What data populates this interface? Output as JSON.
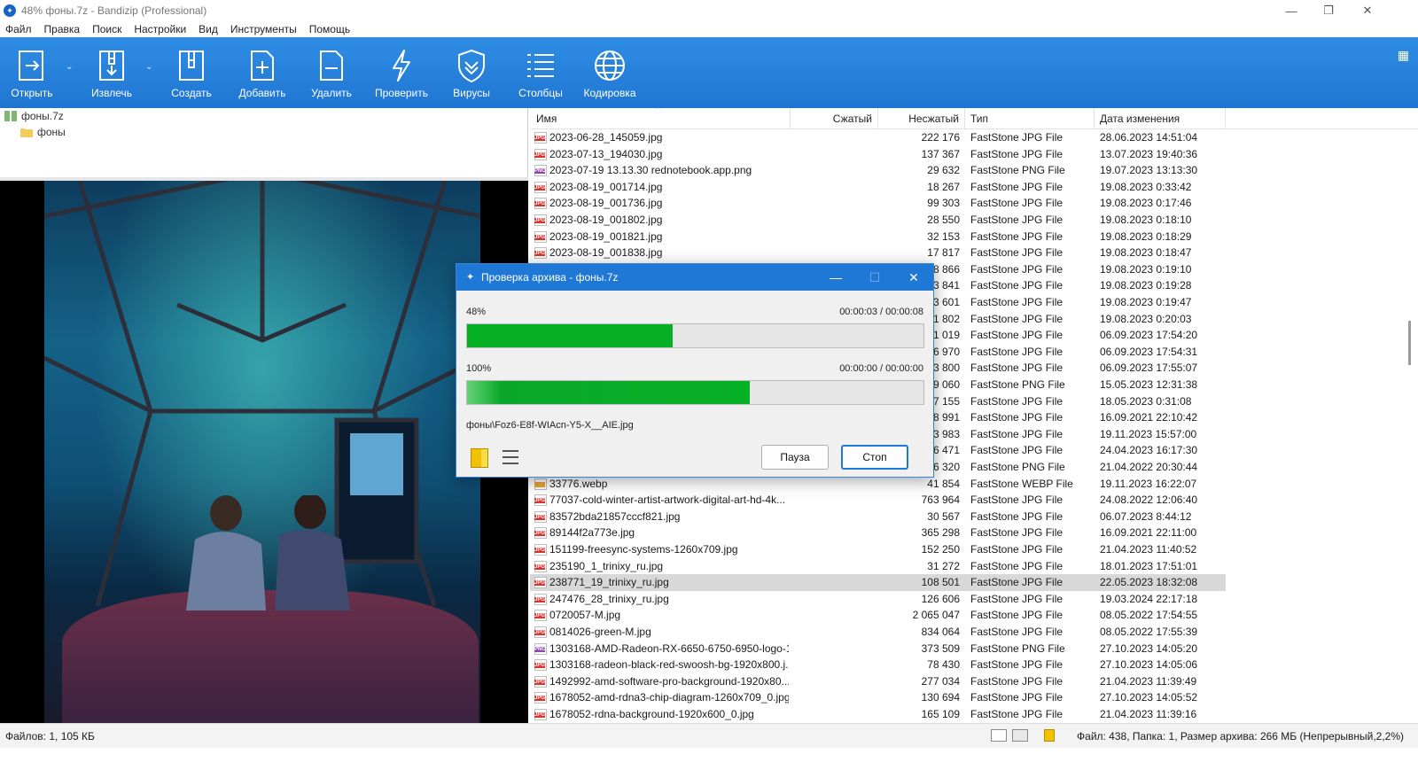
{
  "window": {
    "title": "48% фоны.7z - Bandizip (Professional)",
    "controls": {
      "minimize": "—",
      "maximize": "❐",
      "close": "✕"
    }
  },
  "menu": [
    "Файл",
    "Правка",
    "Поиск",
    "Настройки",
    "Вид",
    "Инструменты",
    "Помощь"
  ],
  "toolbar": {
    "open": "Открыть",
    "extract": "Извлечь",
    "create": "Создать",
    "add": "Добавить",
    "delete": "Удалить",
    "test": "Проверить",
    "virus": "Вирусы",
    "columns": "Столбцы",
    "encoding": "Кодировка"
  },
  "tree": {
    "archive": "фоны.7z",
    "folder": "фоны"
  },
  "columns": {
    "name": "Имя",
    "packed": "Сжатый",
    "size": "Несжатый",
    "type": "Тип",
    "modified": "Дата изменения"
  },
  "files": [
    {
      "icon": "jpg",
      "name": "2023-06-28_145059.jpg",
      "size": "222 176",
      "type": "FastStone JPG File",
      "date": "28.06.2023 14:51:04"
    },
    {
      "icon": "jpg",
      "name": "2023-07-13_194030.jpg",
      "size": "137 367",
      "type": "FastStone JPG File",
      "date": "13.07.2023 19:40:36"
    },
    {
      "icon": "png",
      "name": "2023-07-19 13.13.30 rednotebook.app.png",
      "size": "29 632",
      "type": "FastStone PNG File",
      "date": "19.07.2023 13:13:30"
    },
    {
      "icon": "jpg",
      "name": "2023-08-19_001714.jpg",
      "size": "18 267",
      "type": "FastStone JPG File",
      "date": "19.08.2023 0:33:42"
    },
    {
      "icon": "jpg",
      "name": "2023-08-19_001736.jpg",
      "size": "99 303",
      "type": "FastStone JPG File",
      "date": "19.08.2023 0:17:46"
    },
    {
      "icon": "jpg",
      "name": "2023-08-19_001802.jpg",
      "size": "28 550",
      "type": "FastStone JPG File",
      "date": "19.08.2023 0:18:10"
    },
    {
      "icon": "jpg",
      "name": "2023-08-19_001821.jpg",
      "size": "32 153",
      "type": "FastStone JPG File",
      "date": "19.08.2023 0:18:29"
    },
    {
      "icon": "jpg",
      "name": "2023-08-19_001838.jpg",
      "size": "17 817",
      "type": "FastStone JPG File",
      "date": "19.08.2023 0:18:47"
    },
    {
      "icon": "jpg",
      "name": "",
      "size": "8 866",
      "type": "FastStone JPG File",
      "date": "19.08.2023 0:19:10"
    },
    {
      "icon": "jpg",
      "name": "",
      "size": "3 841",
      "type": "FastStone JPG File",
      "date": "19.08.2023 0:19:28"
    },
    {
      "icon": "jpg",
      "name": "",
      "size": "3 601",
      "type": "FastStone JPG File",
      "date": "19.08.2023 0:19:47"
    },
    {
      "icon": "jpg",
      "name": "",
      "size": "1 802",
      "type": "FastStone JPG File",
      "date": "19.08.2023 0:20:03"
    },
    {
      "icon": "jpg",
      "name": "",
      "size": "1 019",
      "type": "FastStone JPG File",
      "date": "06.09.2023 17:54:20"
    },
    {
      "icon": "jpg",
      "name": "",
      "size": "6 970",
      "type": "FastStone JPG File",
      "date": "06.09.2023 17:54:31"
    },
    {
      "icon": "jpg",
      "name": "",
      "size": "3 800",
      "type": "FastStone JPG File",
      "date": "06.09.2023 17:55:07"
    },
    {
      "icon": "png",
      "name": "",
      "size": "9 060",
      "type": "FastStone PNG File",
      "date": "15.05.2023 12:31:38"
    },
    {
      "icon": "jpg",
      "name": "",
      "size": "7 155",
      "type": "FastStone JPG File",
      "date": "18.05.2023 0:31:08"
    },
    {
      "icon": "jpg",
      "name": "",
      "size": "8 991",
      "type": "FastStone JPG File",
      "date": "16.09.2021 22:10:42"
    },
    {
      "icon": "jpg",
      "name": "",
      "size": "3 983",
      "type": "FastStone JPG File",
      "date": "19.11.2023 15:57:00"
    },
    {
      "icon": "jpg",
      "name": "",
      "size": "6 471",
      "type": "FastStone JPG File",
      "date": "24.04.2023 16:17:30"
    },
    {
      "icon": "png",
      "name": "",
      "size": "6 320",
      "type": "FastStone PNG File",
      "date": "21.04.2022 20:30:44"
    },
    {
      "icon": "webp",
      "name": "33776.webp",
      "size": "41 854",
      "type": "FastStone WEBP File",
      "date": "19.11.2023 16:22:07"
    },
    {
      "icon": "jpg",
      "name": "77037-cold-winter-artist-artwork-digital-art-hd-4k...",
      "size": "763 964",
      "type": "FastStone JPG File",
      "date": "24.08.2022 12:06:40"
    },
    {
      "icon": "jpg",
      "name": "83572bda21857cccf821.jpg",
      "size": "30 567",
      "type": "FastStone JPG File",
      "date": "06.07.2023 8:44:12"
    },
    {
      "icon": "jpg",
      "name": "89144f2a773e.jpg",
      "size": "365 298",
      "type": "FastStone JPG File",
      "date": "16.09.2021 22:11:00"
    },
    {
      "icon": "jpg",
      "name": "151199-freesync-systems-1260x709.jpg",
      "size": "152 250",
      "type": "FastStone JPG File",
      "date": "21.04.2023 11:40:52"
    },
    {
      "icon": "jpg",
      "name": "235190_1_trinixy_ru.jpg",
      "size": "31 272",
      "type": "FastStone JPG File",
      "date": "18.01.2023 17:51:01"
    },
    {
      "icon": "jpg",
      "name": "238771_19_trinixy_ru.jpg",
      "size": "108 501",
      "type": "FastStone JPG File",
      "date": "22.05.2023 18:32:08",
      "selected": true
    },
    {
      "icon": "jpg",
      "name": "247476_28_trinixy_ru.jpg",
      "size": "126 606",
      "type": "FastStone JPG File",
      "date": "19.03.2024 22:17:18"
    },
    {
      "icon": "jpg",
      "name": "0720057-M.jpg",
      "size": "2 065 047",
      "type": "FastStone JPG File",
      "date": "08.05.2022 17:54:55"
    },
    {
      "icon": "jpg",
      "name": "0814026-green-M.jpg",
      "size": "834 064",
      "type": "FastStone JPG File",
      "date": "08.05.2022 17:55:39"
    },
    {
      "icon": "png",
      "name": "1303168-AMD-Radeon-RX-6650-6750-6950-logo-1...",
      "size": "373 509",
      "type": "FastStone PNG File",
      "date": "27.10.2023 14:05:20"
    },
    {
      "icon": "jpg",
      "name": "1303168-radeon-black-red-swoosh-bg-1920x800.j...",
      "size": "78 430",
      "type": "FastStone JPG File",
      "date": "27.10.2023 14:05:06"
    },
    {
      "icon": "jpg",
      "name": "1492992-amd-software-pro-background-1920x80...",
      "size": "277 034",
      "type": "FastStone JPG File",
      "date": "21.04.2023 11:39:49"
    },
    {
      "icon": "jpg",
      "name": "1678052-amd-rdna3-chip-diagram-1260x709_0.jpg",
      "size": "130 694",
      "type": "FastStone JPG File",
      "date": "27.10.2023 14:05:52"
    },
    {
      "icon": "jpg",
      "name": "1678052-rdna-background-1920x600_0.jpg",
      "size": "165 109",
      "type": "FastStone JPG File",
      "date": "21.04.2023 11:39:16"
    }
  ],
  "icon_tags": {
    "jpg": "JPG",
    "png": "PNG",
    "webp": ""
  },
  "icon_colors": {
    "jpg": "#d9342b",
    "png": "#8e44ad",
    "webp": "#e8a33b"
  },
  "status": {
    "left": "Файлов: 1, 105 КБ",
    "right": "Файл: 438, Папка: 1, Размер архива: 266 МБ (Непрерывный,2,2%)"
  },
  "dialog": {
    "title": "Проверка архива - фоны.7z",
    "progress1": {
      "label": "48%",
      "time": "00:00:03 / 00:00:08",
      "fraction": 0.45
    },
    "progress2": {
      "label": "100%",
      "time": "00:00:00 / 00:00:00",
      "fraction": 0.62
    },
    "current_file": "фоны\\Foz6-E8f-WIAcn-Y5-X__AIE.jpg",
    "pause": "Пауза",
    "stop": "Стоп"
  }
}
